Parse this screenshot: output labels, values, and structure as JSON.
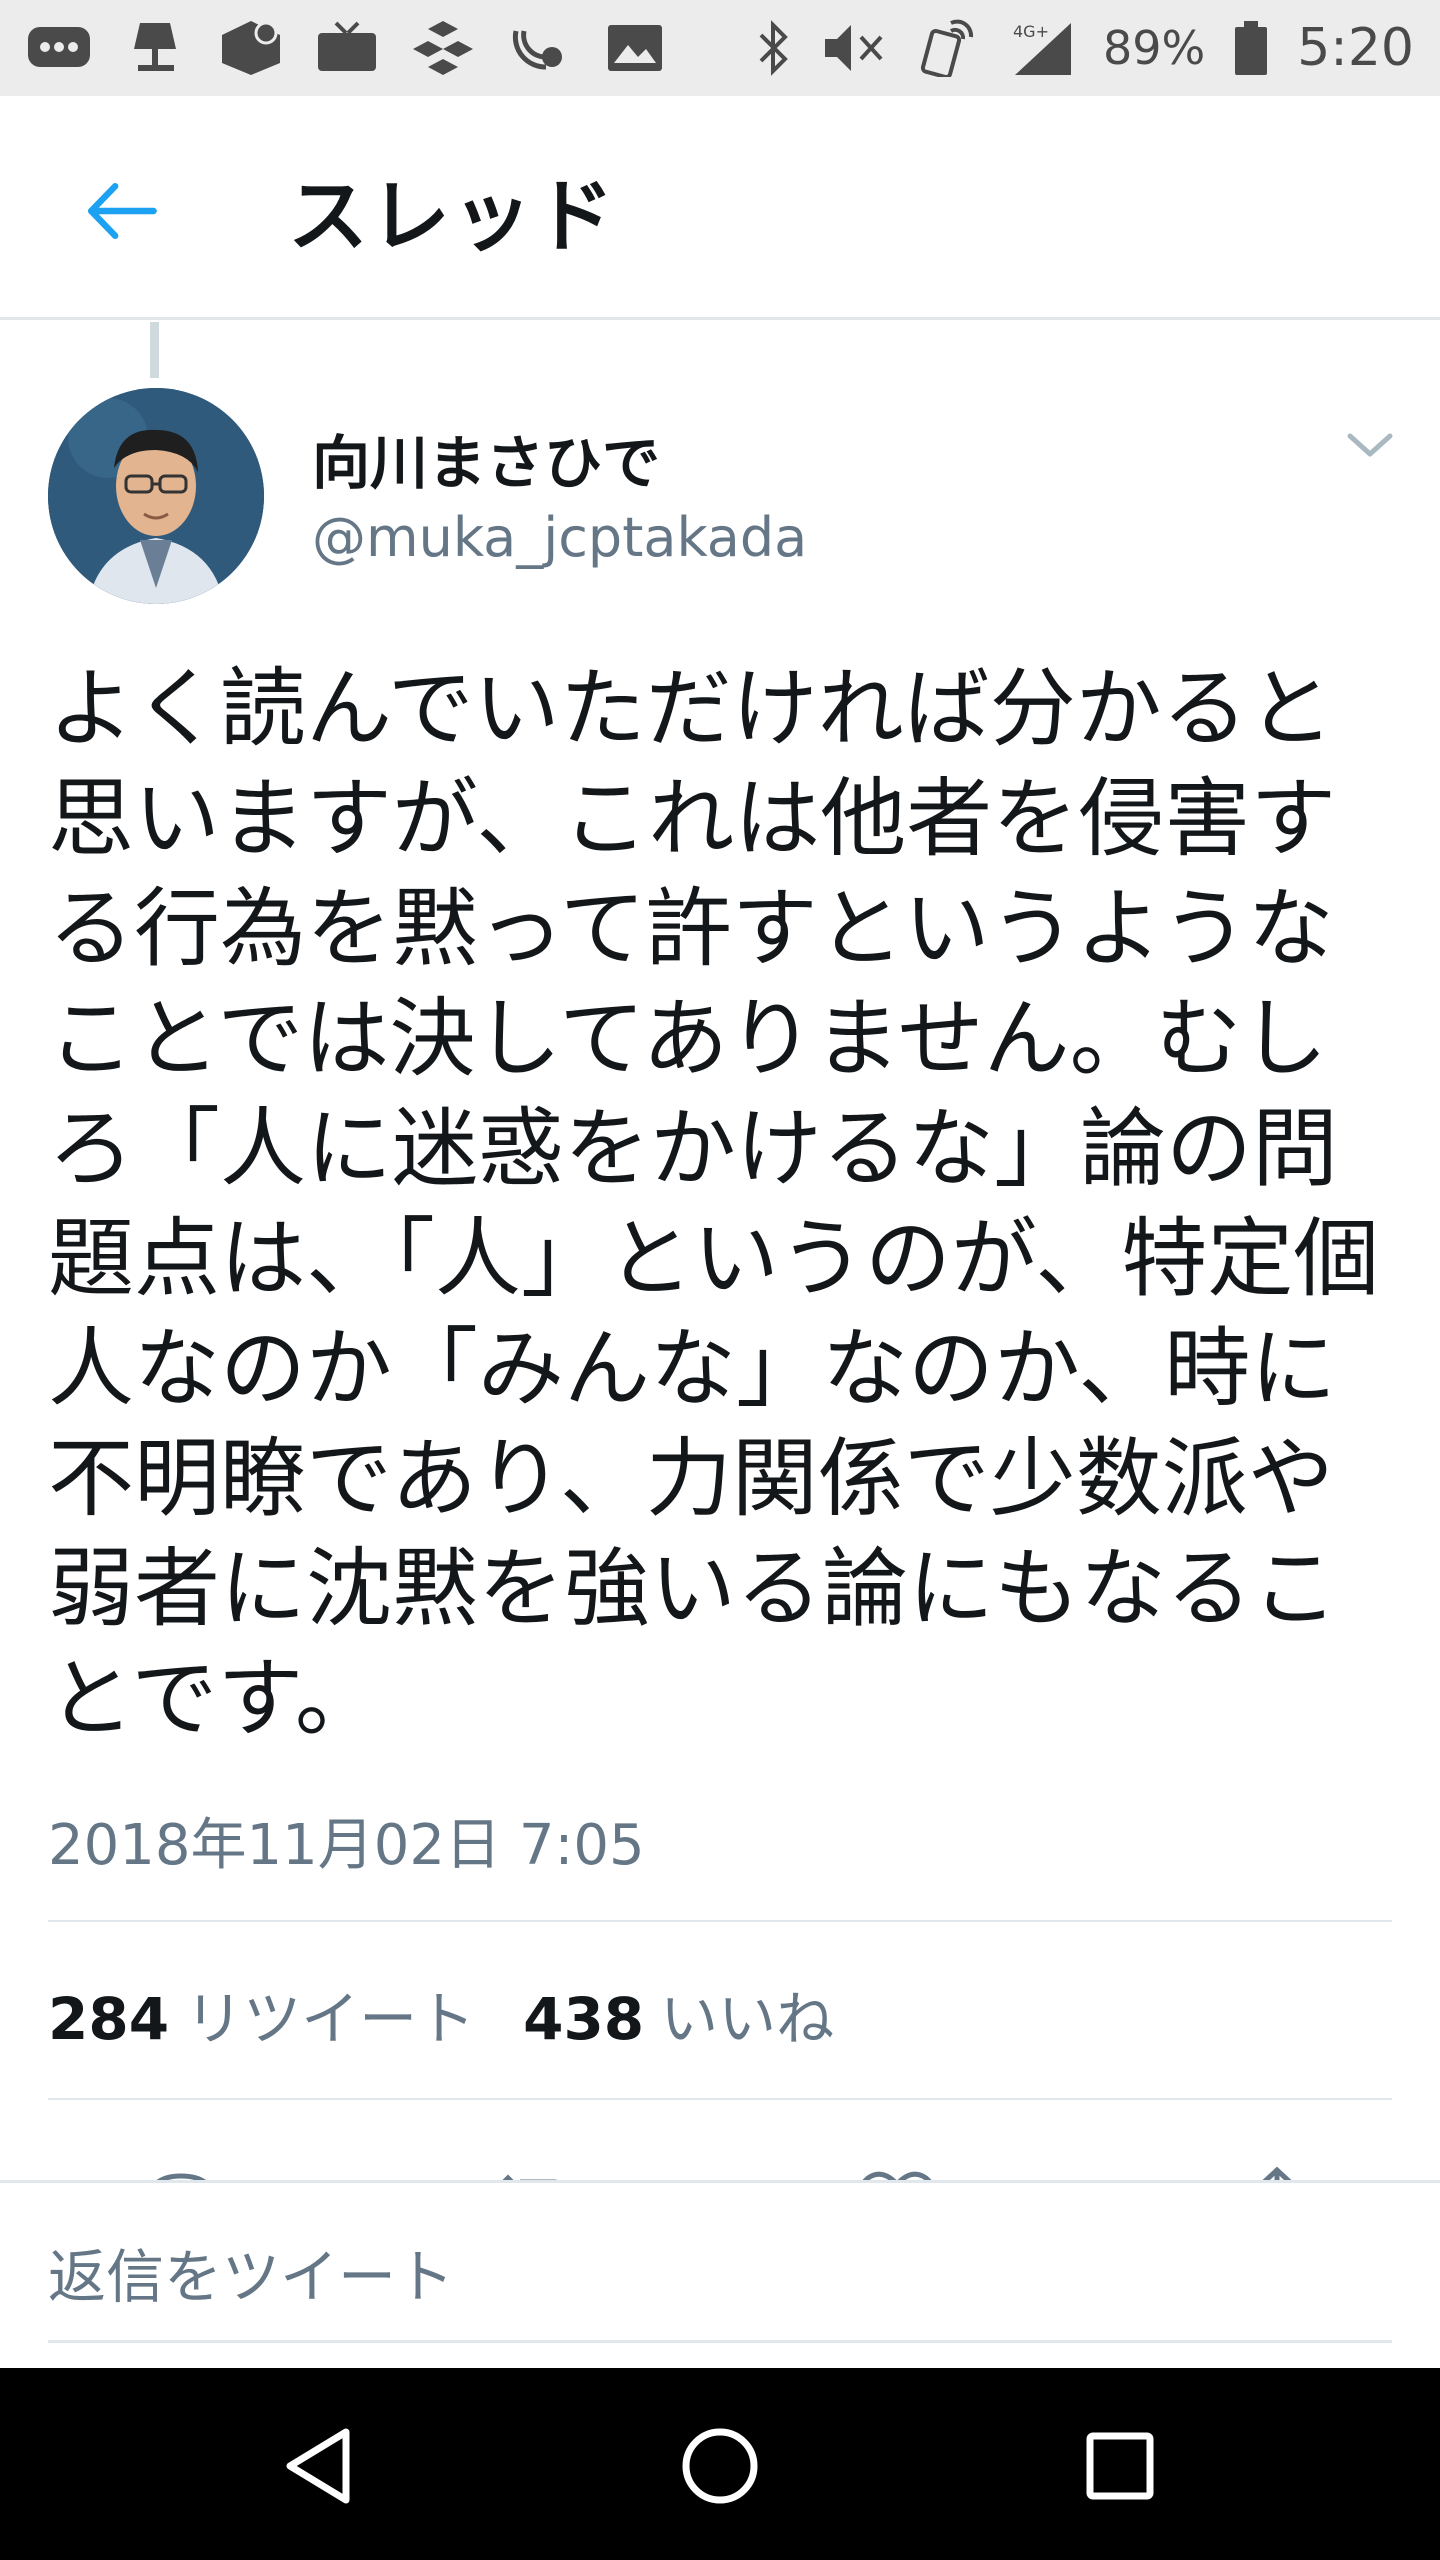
{
  "status_bar": {
    "icons": [
      "chat-icon",
      "lamp-icon",
      "app-icon",
      "tv-icon",
      "cubes-icon",
      "satellite-icon",
      "image-icon",
      "bluetooth-icon",
      "mute-icon",
      "nfc-icon",
      "signal-icon",
      "battery-icon"
    ],
    "network": "4G+",
    "battery": "89%",
    "time": "5:20"
  },
  "header": {
    "title": "スレッド",
    "back_icon": "back-arrow-icon"
  },
  "tweet": {
    "author_name": "向川まさひで",
    "handle": "@muka_jcptakada",
    "text": "よく読んでいただければ分かると思いますが、これは他者を侵害する行為を黙って許すというようなことでは決してありません。むしろ「人に迷惑をかけるな」論の問題点は、「人」というのが、特定個人なのか「みんな」なのか、時に不明瞭であり、力関係で少数派や弱者に沈黙を強いる論にもなることです。",
    "timestamp": "2018年11月02日 7:05",
    "retweet_count": "284",
    "retweet_label": "リツイート",
    "like_count": "438",
    "like_label": "いいね"
  },
  "actions": [
    "reply-icon",
    "retweet-icon",
    "like-icon",
    "share-icon"
  ],
  "reply_bar": {
    "placeholder": "返信をツイート"
  },
  "nav_bar": {
    "buttons": [
      "back-triangle-icon",
      "home-circle-icon",
      "recents-square-icon"
    ]
  },
  "colors": {
    "accent": "#1da1f2",
    "text_primary": "#14171a",
    "text_secondary": "#657786",
    "status_bar_bg": "#ececec",
    "nav_bar_bg": "#000000"
  }
}
